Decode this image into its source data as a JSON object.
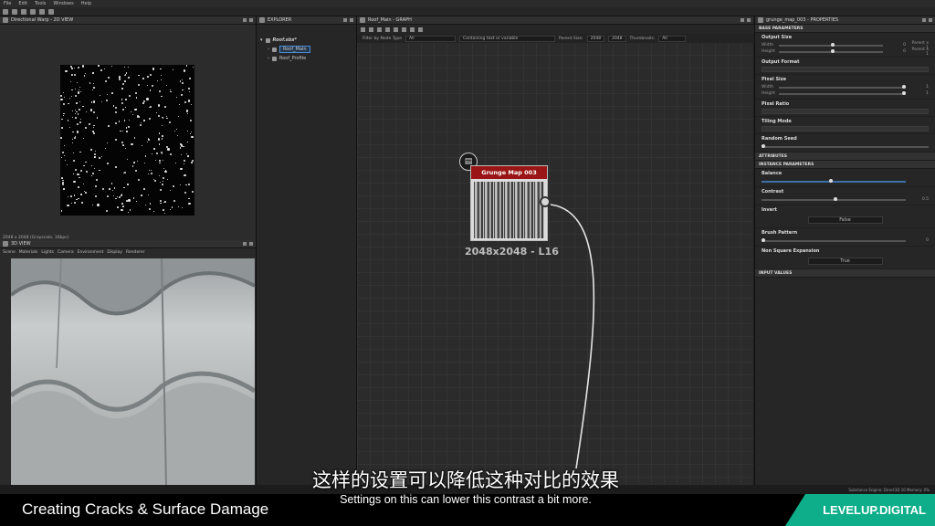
{
  "menubar": {
    "items": [
      "File",
      "Edit",
      "Tools",
      "Windows",
      "Help"
    ]
  },
  "panel_2d": {
    "title": "Directional Warp - 2D VIEW",
    "resolution": "2048 x 2048 (Grayscale, 16bpc)",
    "zoom": "17.87%"
  },
  "panel_3d": {
    "title": "3D VIEW",
    "menu": [
      "Scene",
      "Materials",
      "Lights",
      "Camera",
      "Environment",
      "Display",
      "Renderer"
    ]
  },
  "explorer": {
    "title": "EXPLORER",
    "package": "Roof.sbs*",
    "items": [
      "Roof_Main",
      "Roof_Profile"
    ]
  },
  "graph": {
    "title": "Roof_Main - GRAPH",
    "filter_label": "Filter by Node Type",
    "filter_value": "All",
    "text_filter": "Containing text or variable",
    "parent_size_label": "Parent Size:",
    "parent_size": "2048",
    "size2": "2048",
    "thumbnails_label": "Thumbnails:",
    "thumbnails": "All",
    "node_title": "Grunge Map 003",
    "node_label": "2048x2048 - L16"
  },
  "properties": {
    "title": "grunge_map_003 - PROPERTIES",
    "base_section": "BASE PARAMETERS",
    "output_size": "Output Size",
    "width_label": "Width",
    "height_label": "Height",
    "width_val": "0",
    "width_mode": "Parent x 1",
    "height_val": "0",
    "height_mode": "Parent x 1",
    "output_format": "Output Format",
    "pixel_size": "Pixel Size",
    "ps_width_val": "1",
    "ps_height_val": "1",
    "pixel_ratio": "Pixel Ratio",
    "tiling_mode": "Tiling Mode",
    "random_seed": "Random Seed",
    "attributes": "ATTRIBUTES",
    "instance_section": "INSTANCE PARAMETERS",
    "balance": "Balance",
    "contrast": "Contrast",
    "contrast_val": "0.5",
    "invert": "Invert",
    "invert_val": "False",
    "brush_pattern": "Brush Pattern",
    "brush_val": "0",
    "non_square": "Non Square Expansion",
    "non_square_val": "True",
    "input_values": "INPUT VALUES"
  },
  "status": "Substance Engine: Direct3D 10   Memory: 0%",
  "subtitles": {
    "cn": "这样的设置可以降低这种对比的效果",
    "en": "Settings on this can lower this contrast a bit more."
  },
  "course_title": "Creating Cracks & Surface Damage",
  "brand": "LEVELUP.DIGITAL",
  "colors": {
    "node_header": "#9a1515",
    "brand": "#0fae8b",
    "selection": "#4d8dd6"
  }
}
